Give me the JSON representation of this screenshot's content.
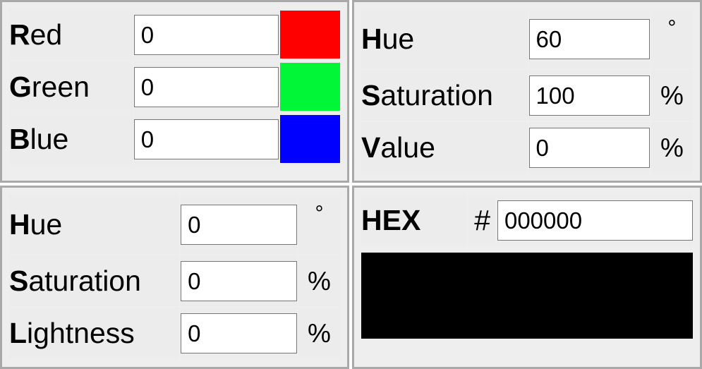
{
  "rgb_panel": {
    "rows": [
      {
        "accesskey": "R",
        "rest": "ed",
        "value": "0",
        "swatch_color": "#ff0000"
      },
      {
        "accesskey": "G",
        "rest": "reen",
        "value": "0",
        "swatch_color": "#00f637"
      },
      {
        "accesskey": "B",
        "rest": "lue",
        "value": "0",
        "swatch_color": "#0000ff"
      }
    ]
  },
  "hsv_panel": {
    "rows": [
      {
        "accesskey": "H",
        "rest": "ue",
        "value": "60",
        "unit": "°"
      },
      {
        "accesskey": "S",
        "rest": "aturation",
        "value": "100",
        "unit": "%"
      },
      {
        "accesskey": "V",
        "rest": "alue",
        "value": "0",
        "unit": "%"
      }
    ]
  },
  "hsl_panel": {
    "rows": [
      {
        "accesskey": "H",
        "rest": "ue",
        "value": "0",
        "unit": "°"
      },
      {
        "accesskey": "S",
        "rest": "aturation",
        "value": "0",
        "unit": "%"
      },
      {
        "accesskey": "L",
        "rest": "ightness",
        "value": "0",
        "unit": "%"
      }
    ]
  },
  "hex_panel": {
    "label": "HEX",
    "hash": "#",
    "value": "000000",
    "preview_color": "#000000"
  }
}
